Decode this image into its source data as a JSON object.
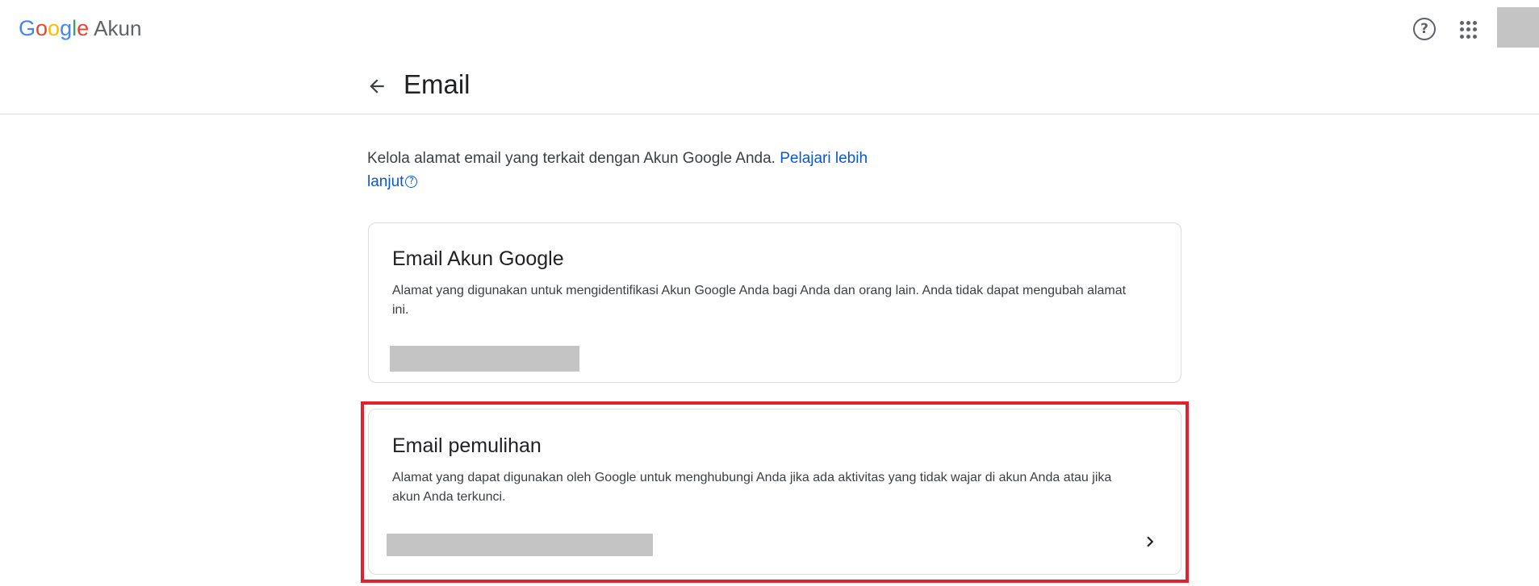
{
  "header": {
    "logo_letters": [
      "G",
      "o",
      "o",
      "g",
      "l",
      "e"
    ],
    "logo_colors": [
      "#4285F4",
      "#EA4335",
      "#FBBC05",
      "#4285F4",
      "#34A853",
      "#EA4335"
    ],
    "product": "Akun",
    "help_icon": "?",
    "icons": {
      "help": "help-circle-icon",
      "apps": "apps-grid-icon"
    }
  },
  "page": {
    "title": "Email",
    "back_icon": "arrow-back-icon"
  },
  "intro": {
    "text": "Kelola alamat email yang terkait dengan Akun Google Anda.",
    "link_text": "Pelajari lebih lanjut",
    "info_icon": "?"
  },
  "cards": [
    {
      "title": "Email Akun Google",
      "description": "Alamat yang digunakan untuk mengidentifikasi Akun Google Anda bagi Anda dan orang lain. Anda tidak dapat mengubah alamat ini."
    },
    {
      "title": "Email pemulihan",
      "description": "Alamat yang dapat digunakan oleh Google untuk menghubungi Anda jika ada aktivitas yang tidak wajar di akun Anda atau jika akun Anda terkunci.",
      "chevron_icon": "chevron-right-icon"
    }
  ],
  "colors": {
    "link": "#0b57d0",
    "highlight": "#e3202b",
    "redaction": "#c4c4c4"
  }
}
